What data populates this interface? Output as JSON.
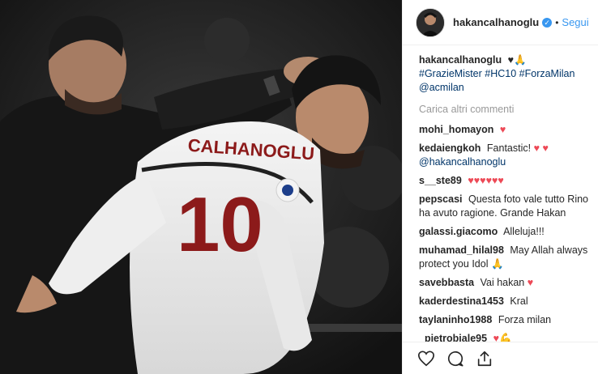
{
  "post": {
    "username": "hakancalhanoglu",
    "verified_mark": "✓",
    "dot": "•",
    "follow_label": "Segui",
    "caption_user": "hakancalhanoglu",
    "caption_emojis": "♥🙏",
    "caption_hashtags": "#GrazieMister #HC10 #ForzaMilan @acmilan",
    "load_more": "Carica altri commenti"
  },
  "comments": [
    {
      "user": "mohi_homayon",
      "text": "",
      "emoji": "♥"
    },
    {
      "user": "kedaiengkoh",
      "text": "Fantastic!",
      "emoji": "♥ ♥",
      "mention": "@hakancalhanoglu"
    },
    {
      "user": "s__ste89",
      "text": "",
      "emoji": "♥♥♥♥♥♥"
    },
    {
      "user": "pepscasi",
      "text": "Questa foto vale tutto Rino ha avuto ragione. Grande Hakan",
      "emoji": ""
    },
    {
      "user": "galassi.giacomo",
      "text": "Alleluja!!!",
      "emoji": ""
    },
    {
      "user": "muhamad_hilal98",
      "text": "May Allah always protect you Idol",
      "emoji": "🙏"
    },
    {
      "user": "savebbasta",
      "text": "Vai hakan",
      "emoji": "♥"
    },
    {
      "user": "kaderdestina1453",
      "text": "Kral",
      "emoji": ""
    },
    {
      "user": "taylaninho1988",
      "text": "Forza milan",
      "emoji": ""
    },
    {
      "user": "_pietrobiale95",
      "text": "",
      "emoji": "♥💪"
    }
  ],
  "photo": {
    "jersey_name": "CALHANOGLU",
    "jersey_number": "10"
  },
  "icons": {
    "like": "heart-icon",
    "comment": "comment-icon",
    "share": "share-icon",
    "verified": "verified-icon"
  },
  "colors": {
    "accent": "#3897f0",
    "heart": "#ed4956",
    "text": "#262626",
    "muted": "#999999",
    "hashtag": "#003569"
  }
}
